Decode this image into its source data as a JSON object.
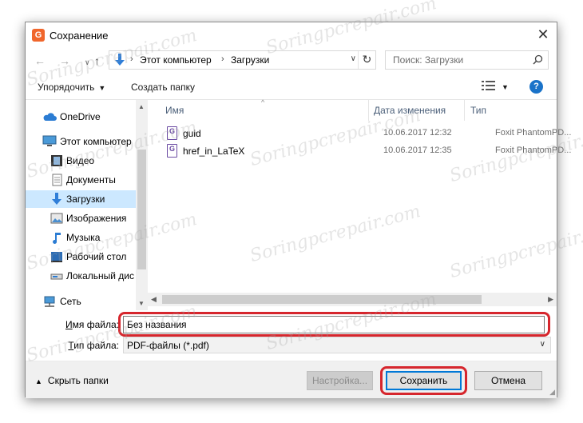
{
  "window": {
    "title": "Сохранение",
    "app_icon": "foxit-app-icon",
    "close_label": "✕"
  },
  "nav": {
    "back": "←",
    "forward": "→",
    "up": "↑",
    "breadcrumb": [
      "Этот компьютер",
      "Загрузки"
    ],
    "search_placeholder": "Поиск: Загрузки"
  },
  "toolbar": {
    "organize_label": "Упорядочить",
    "new_folder_label": "Создать папку",
    "help_label": "?"
  },
  "sidebar": {
    "items": [
      {
        "label": "OneDrive",
        "icon": "cloud-icon"
      },
      {
        "label": "Этот компьютер",
        "icon": "computer-icon"
      },
      {
        "label": "Видео",
        "icon": "video-icon"
      },
      {
        "label": "Документы",
        "icon": "documents-icon"
      },
      {
        "label": "Загрузки",
        "icon": "download-icon",
        "selected": true
      },
      {
        "label": "Изображения",
        "icon": "pictures-icon"
      },
      {
        "label": "Музыка",
        "icon": "music-icon"
      },
      {
        "label": "Рабочий стол",
        "icon": "desktop-icon"
      },
      {
        "label": "Локальный дис",
        "icon": "drive-icon"
      },
      {
        "label": "Сеть",
        "icon": "network-icon"
      }
    ]
  },
  "files": {
    "columns": [
      "Имя",
      "Дата изменения",
      "Тип"
    ],
    "rows": [
      {
        "name": "guid",
        "date": "10.06.2017 12:32",
        "type": "Foxit PhantomPD..."
      },
      {
        "name": "href_in_LaTeX",
        "date": "10.06.2017 12:35",
        "type": "Foxit PhantomPD..."
      }
    ]
  },
  "form": {
    "filename_label_u": "И",
    "filename_label_rest": "мя файла:",
    "filename_value": "Без названия",
    "filetype_label_u": "Т",
    "filetype_label_rest": "ип файла:",
    "filetype_value": "PDF-файлы (*.pdf)"
  },
  "footer": {
    "hide_folders_label": "Скрыть папки",
    "settings_label": "Настройка...",
    "save_label": "Сохранить",
    "cancel_label": "Отмена"
  },
  "watermark": "Soringpcrepair.com",
  "colors": {
    "accent": "#0078d7",
    "highlight": "#d6262d",
    "selected_row": "#cce8ff"
  }
}
